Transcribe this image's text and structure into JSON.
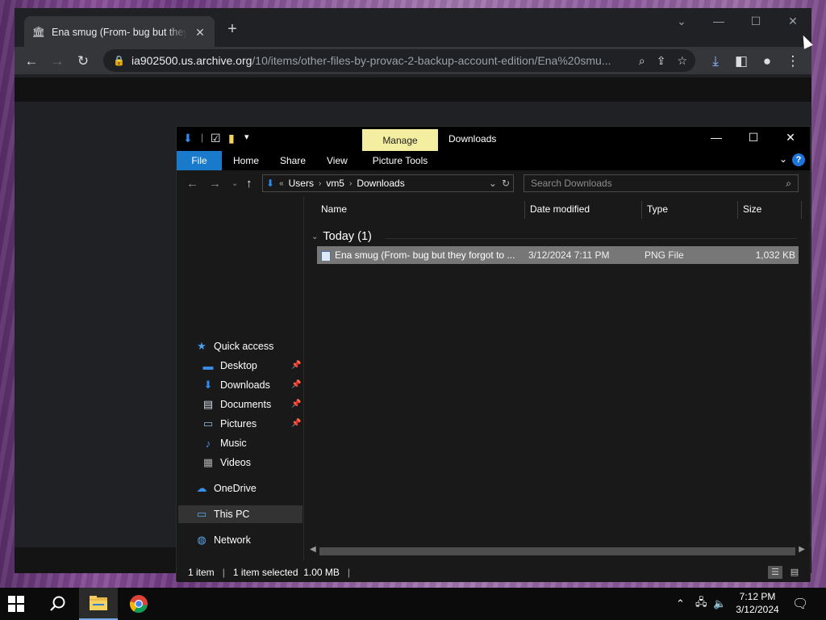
{
  "browser": {
    "tab_title": "Ena smug (From- bug but they fo",
    "url_host": "ia902500.us.archive.org",
    "url_path": "/10/items/other-files-by-provac-2-backup-account-edition/Ena%20smu..."
  },
  "explorer": {
    "title": "Downloads",
    "manage_label": "Manage",
    "picture_tools_label": "Picture Tools",
    "ribbon_tabs": {
      "file": "File",
      "home": "Home",
      "share": "Share",
      "view": "View"
    },
    "help": "?",
    "breadcrumb": {
      "overflow": "«",
      "items": [
        "Users",
        "vm5",
        "Downloads"
      ]
    },
    "search_placeholder": "Search Downloads",
    "nav": {
      "quick_access": "Quick access",
      "desktop": "Desktop",
      "downloads": "Downloads",
      "documents": "Documents",
      "pictures": "Pictures",
      "music": "Music",
      "videos": "Videos",
      "onedrive": "OneDrive",
      "this_pc": "This PC",
      "network": "Network"
    },
    "columns": {
      "name": "Name",
      "date": "Date modified",
      "type": "Type",
      "size": "Size"
    },
    "group_label": "Today (1)",
    "files": [
      {
        "name": "Ena smug (From- bug but they forgot to ...",
        "date": "3/12/2024 7:11 PM",
        "type": "PNG File",
        "size": "1,032 KB"
      }
    ],
    "status": {
      "items": "1 item",
      "selected": "1 item selected  1.00 MB"
    }
  },
  "taskbar": {
    "time": "7:12 PM",
    "date": "3/12/2024"
  },
  "colors": {
    "file_tab": "#1979ca",
    "manage_tab": "#f3eea0",
    "selection": "#777777"
  }
}
